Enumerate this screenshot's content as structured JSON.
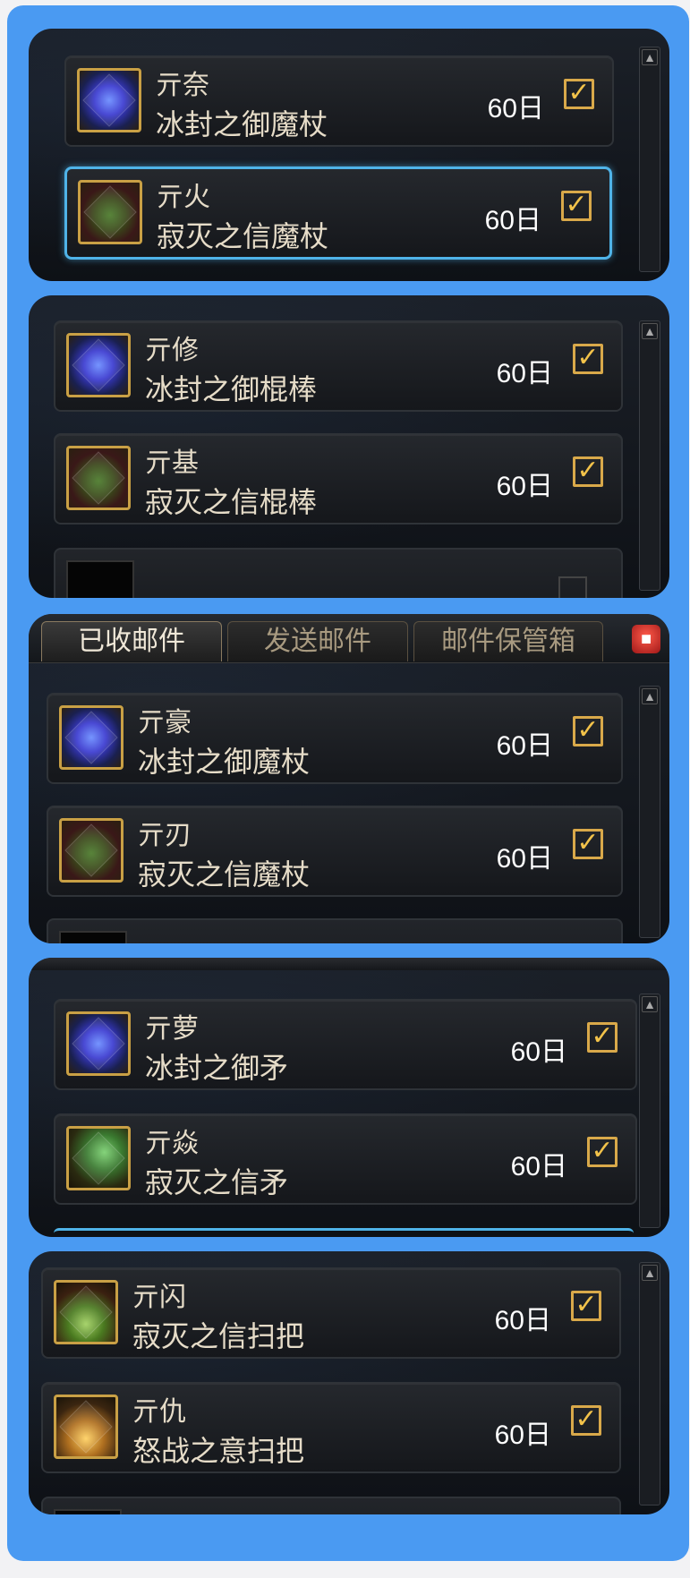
{
  "tabs": {
    "received": "已收邮件",
    "sent": "发送邮件",
    "storage": "邮件保管箱"
  },
  "panels": [
    {
      "items": [
        {
          "sender": "亓奈",
          "item": "冰封之御魔杖",
          "duration": "60日",
          "icon": "staff-ice-icon",
          "selected": false
        },
        {
          "sender": "亓火",
          "item": "寂灭之信魔杖",
          "duration": "60日",
          "icon": "staff-dark-icon",
          "selected": true
        }
      ]
    },
    {
      "items": [
        {
          "sender": "亓修",
          "item": "冰封之御棍棒",
          "duration": "60日",
          "icon": "club-ice-icon",
          "selected": false
        },
        {
          "sender": "亓基",
          "item": "寂灭之信棍棒",
          "duration": "60日",
          "icon": "club-dark-icon",
          "selected": false
        }
      ]
    },
    {
      "items": [
        {
          "sender": "亓豪",
          "item": "冰封之御魔杖",
          "duration": "60日",
          "icon": "staff-ice-icon",
          "selected": false
        },
        {
          "sender": "亓刃",
          "item": "寂灭之信魔杖",
          "duration": "60日",
          "icon": "staff-dark-icon",
          "selected": false
        }
      ]
    },
    {
      "items": [
        {
          "sender": "亓萝",
          "item": "冰封之御矛",
          "duration": "60日",
          "icon": "spear-ice-icon",
          "selected": false
        },
        {
          "sender": "亓焱",
          "item": "寂灭之信矛",
          "duration": "60日",
          "icon": "spear-dark-icon",
          "selected": false
        }
      ]
    },
    {
      "items": [
        {
          "sender": "亓闪",
          "item": "寂灭之信扫把",
          "duration": "60日",
          "icon": "broom-dark-icon",
          "selected": false
        },
        {
          "sender": "亓仇",
          "item": "怒战之意扫把",
          "duration": "60日",
          "icon": "broom-fury-icon",
          "selected": false
        }
      ]
    }
  ],
  "checkmark": "✓",
  "scroll_up": "▲",
  "colors": {
    "frame": "#4a9af2",
    "selection": "#4fb3e8",
    "check": "#d9a94a"
  }
}
